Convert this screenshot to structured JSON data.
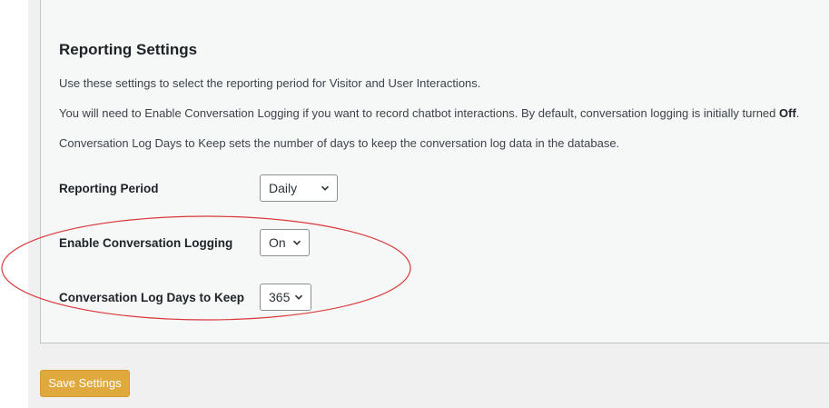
{
  "settings": {
    "title": "Reporting Settings",
    "desc1": "Use these settings to select the reporting period for Visitor and User Interactions.",
    "desc2_prefix": "You will need to Enable Conversation Logging if you want to record chatbot interactions. By default, conversation logging is initially turned ",
    "desc2_bold": "Off",
    "desc2_suffix": ".",
    "desc3": "Conversation Log Days to Keep sets the number of days to keep the conversation log data in the database.",
    "reporting_period": {
      "label": "Reporting Period",
      "value": "Daily"
    },
    "conversation_logging": {
      "label": "Enable Conversation Logging",
      "value": "On"
    },
    "log_days": {
      "label": "Conversation Log Days to Keep",
      "value": "365"
    }
  },
  "actions": {
    "save_label": "Save Settings"
  },
  "colors": {
    "save_button": "#e0a93e",
    "annotation_ellipse": "#d9393b",
    "panel_background": "#f6f7f7"
  },
  "icons": [
    "chevron-down-icon"
  ]
}
